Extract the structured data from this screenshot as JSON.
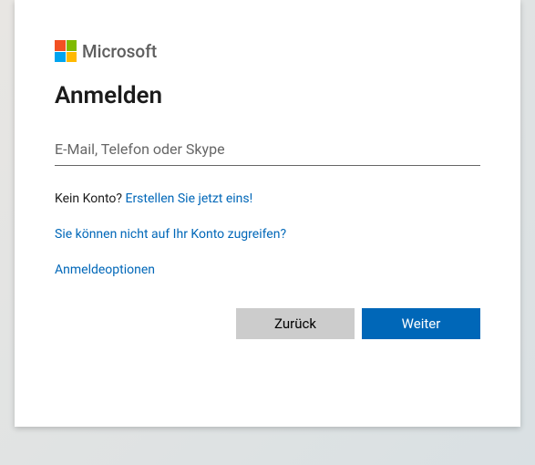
{
  "brand": {
    "name": "Microsoft"
  },
  "header": {
    "title": "Anmelden"
  },
  "form": {
    "identifier_placeholder": "E-Mail, Telefon oder Skype",
    "identifier_value": ""
  },
  "links": {
    "no_account_prefix": "Kein Konto? ",
    "create_account": "Erstellen Sie jetzt eins!",
    "cant_access": "Sie können nicht auf Ihr Konto zugreifen?",
    "signin_options": "Anmeldeoptionen"
  },
  "buttons": {
    "back": "Zurück",
    "next": "Weiter"
  }
}
